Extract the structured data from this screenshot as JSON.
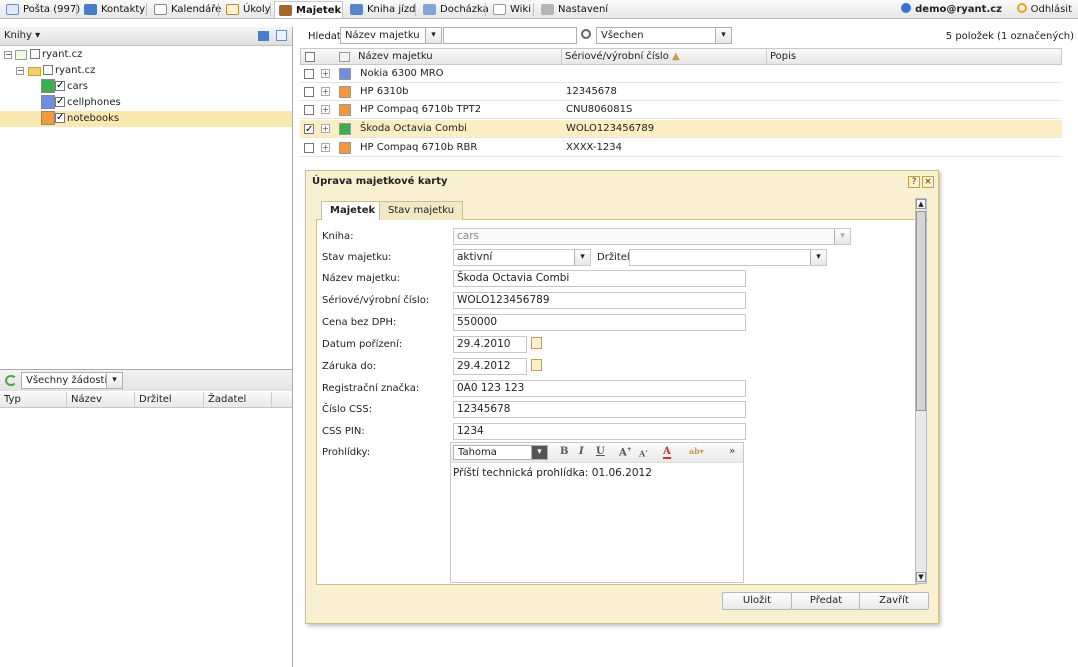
{
  "tabs": [
    {
      "label": "Pošta (997)",
      "icon": "mail-icon"
    },
    {
      "label": "Kontakty",
      "icon": "contacts-icon"
    },
    {
      "label": "Kalendáře",
      "icon": "calendar-icon"
    },
    {
      "label": "Úkoly",
      "icon": "tasks-icon"
    },
    {
      "label": "Majetek",
      "icon": "assets-icon"
    },
    {
      "label": "Kniha jízd",
      "icon": "logbook-icon"
    },
    {
      "label": "Docházka",
      "icon": "attendance-icon"
    },
    {
      "label": "Wiki",
      "icon": "wiki-icon"
    },
    {
      "label": "Nastavení",
      "icon": "settings-icon"
    }
  ],
  "user": {
    "email": "demo@ryant.cz",
    "logout": "Odhlásit"
  },
  "left": {
    "header": "Knihy",
    "tree": [
      {
        "label": "ryant.cz"
      },
      {
        "label": "ryant.cz"
      },
      {
        "label": "cars",
        "color": "#3cae4c"
      },
      {
        "label": "cellphones",
        "color": "#6f8fdc"
      },
      {
        "label": "notebooks",
        "color": "#f09a3c"
      }
    ],
    "requests_filter": "Všechny žádosti",
    "request_columns": [
      "Typ",
      "Název",
      "Držitel",
      "Žadatel"
    ]
  },
  "search": {
    "label": "Hledat:",
    "field": "Název majetku",
    "value": "",
    "filter": "Všechen",
    "count": "5 položek (1 označených)"
  },
  "grid": {
    "columns": [
      "Název majetku",
      "Sériové/výrobní číslo",
      "Popis"
    ],
    "rows": [
      {
        "name": "Nokia 6300 MRO",
        "serial": "",
        "color": "#6f8fdc",
        "checked": false
      },
      {
        "name": "HP 6310b",
        "serial": "12345678",
        "color": "#f09a3c",
        "checked": false
      },
      {
        "name": "HP Compaq 6710b TPT2",
        "serial": "CNU806081S",
        "color": "#f09a3c",
        "checked": false
      },
      {
        "name": "Škoda Octavia Combi",
        "serial": "WOLO123456789",
        "color": "#3cae4c",
        "checked": true
      },
      {
        "name": "HP Compaq 6710b RBR",
        "serial": "XXXX-1234",
        "color": "#f09a3c",
        "checked": false
      }
    ]
  },
  "dialog": {
    "title": "Úprava majetkové karty",
    "help": "?",
    "close": "×",
    "tabs": [
      "Majetek",
      "Stav majetku"
    ],
    "fields": {
      "kniha_label": "Kniha:",
      "kniha_value": "cars",
      "stav_label": "Stav majetku:",
      "stav_value": "aktivní",
      "drzitel_label": "Držitel:",
      "drzitel_value": "",
      "nazev_label": "Název majetku:",
      "nazev_value": "Škoda Octavia Combi",
      "serial_label": "Sériové/výrobní číslo:",
      "serial_value": "WOLO123456789",
      "cena_label": "Cena bez DPH:",
      "cena_value": "550000",
      "datum_label": "Datum pořízení:",
      "datum_value": "29.4.2010",
      "zaruka_label": "Záruka do:",
      "zaruka_value": "29.4.2012",
      "spz_label": "Registrační značka:",
      "spz_value": "0A0 123 123",
      "css_label": "Číslo CSS:",
      "css_value": "12345678",
      "pin_label": "CSS PIN:",
      "pin_value": "1234",
      "prohlidky_label": "Prohlídky:"
    },
    "editor": {
      "font": "Tahoma",
      "content": "Příští technická prohlídka: 01.06.2012"
    },
    "buttons": {
      "save": "Uložit",
      "handover": "Předat",
      "close": "Zavřít"
    }
  }
}
